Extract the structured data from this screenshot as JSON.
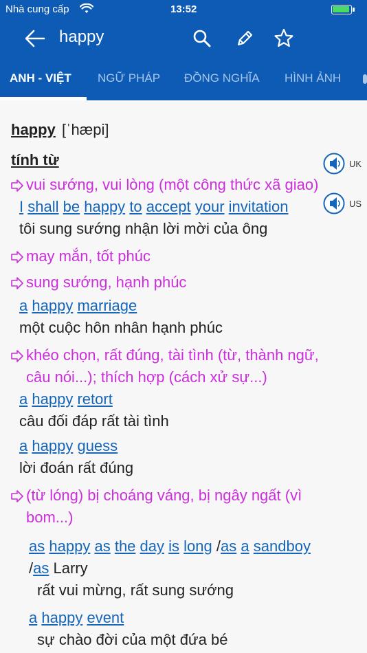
{
  "statusbar": {
    "carrier": "Nhà cung cấp",
    "time": "13:52",
    "battery_level": 0.92
  },
  "navbar": {
    "title": "happy",
    "icons": [
      "back-arrow-icon",
      "search-icon",
      "pencil-icon",
      "star-icon"
    ]
  },
  "tabs": [
    {
      "label": "ANH - VIỆT",
      "active": true
    },
    {
      "label": "NGỮ PHÁP",
      "active": false
    },
    {
      "label": "ĐỒNG NGHĨA",
      "active": false
    },
    {
      "label": "HÌNH ẢNH",
      "active": false
    }
  ],
  "entry": {
    "headword": "happy",
    "phonetic": "[ˈhæpi]",
    "pos": "tính từ",
    "speakers": [
      "UK",
      "US"
    ],
    "senses": [
      {
        "lines": [
          "vui sướng, vui lòng (một công thức xã giao)"
        ],
        "examples": [
          {
            "en": [
              "I",
              "shall",
              "be",
              "happy",
              "to",
              "accept",
              "your",
              "invitation"
            ],
            "vi": "tôi sung sướng nhận lời mời của ông"
          }
        ]
      },
      {
        "lines": [
          "may mắn, tốt phúc"
        ],
        "examples": []
      },
      {
        "lines": [
          "sung sướng, hạnh phúc"
        ],
        "examples": [
          {
            "en": [
              "a",
              "happy",
              "marriage"
            ],
            "vi": "một cuộc hôn nhân hạnh phúc"
          }
        ]
      },
      {
        "lines": [
          "khéo chọn, rất đúng, tài tình (từ, thành ngữ,",
          "câu nói...); thích hợp (cách xử sự...)"
        ],
        "examples": [
          {
            "en": [
              "a",
              "happy",
              "retort"
            ],
            "vi": "câu đối đáp rất tài tình"
          },
          {
            "en": [
              "a",
              "happy",
              "guess"
            ],
            "vi": "lời đoán rất đúng"
          }
        ]
      },
      {
        "lines": [
          "(từ lóng) bị choáng váng, bị ngây ngất (vì",
          "bom...)"
        ],
        "examples": []
      }
    ],
    "idioms": [
      {
        "line1": [
          "as",
          "happy",
          "as",
          "the",
          "day",
          "is",
          "long",
          "/",
          "as",
          "a",
          "sandboy"
        ],
        "line2": [
          "/",
          "as",
          "Larry"
        ],
        "vi": "rất vui mừng, rất sung sướng"
      },
      {
        "line1": [
          "a",
          "happy",
          "event"
        ],
        "line2": [],
        "vi": "sự chào đời của một đứa bé"
      }
    ]
  },
  "colors": {
    "header_blue": "#0d5bb5",
    "tab_inactive": "#a6c6ea",
    "sense_magenta": "#cc2edc",
    "example_blue": "#1566b8",
    "text": "#222222"
  }
}
